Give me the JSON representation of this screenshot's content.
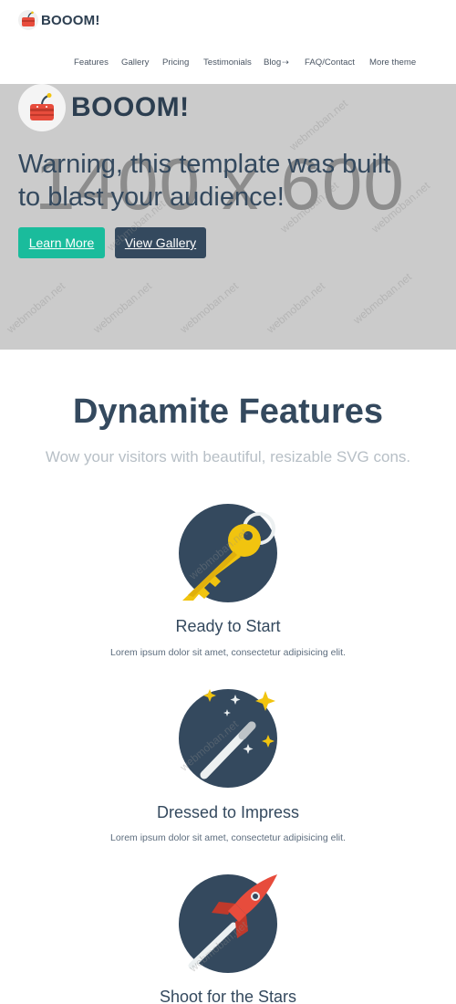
{
  "brand": {
    "name": "BOOOM!"
  },
  "nav": {
    "items": [
      "Features",
      "Gallery",
      "Pricing",
      "Testimonials",
      "Blog",
      "FAQ/Contact",
      "More theme"
    ],
    "blog_suffix": "⇢"
  },
  "hero": {
    "brand": "BOOOM!",
    "placeholder": "1400 x 600",
    "title": "Warning, this template was built to blast your audience!",
    "learn_more": "Learn More",
    "view_gallery": "View Gallery"
  },
  "features": {
    "title": "Dynamite Features",
    "subtitle": "Wow your visitors with beautiful, resizable SVG cons.",
    "items": [
      {
        "title": "Ready to Start",
        "text": "Lorem ipsum dolor sit amet, consectetur adipisicing elit.",
        "icon": "key-icon"
      },
      {
        "title": "Dressed to Impress",
        "text": "Lorem ipsum dolor sit amet, consectetur adipisicing elit.",
        "icon": "magic-wand-icon"
      },
      {
        "title": "Shoot for the Stars",
        "text": "",
        "icon": "rocket-icon"
      }
    ]
  },
  "watermark": "webmoban.net",
  "colors": {
    "primary_dark": "#34495e",
    "teal": "#1abc9c",
    "hero_bg": "#cbcbcb",
    "gold": "#f1c40f",
    "red": "#e74c3c"
  }
}
